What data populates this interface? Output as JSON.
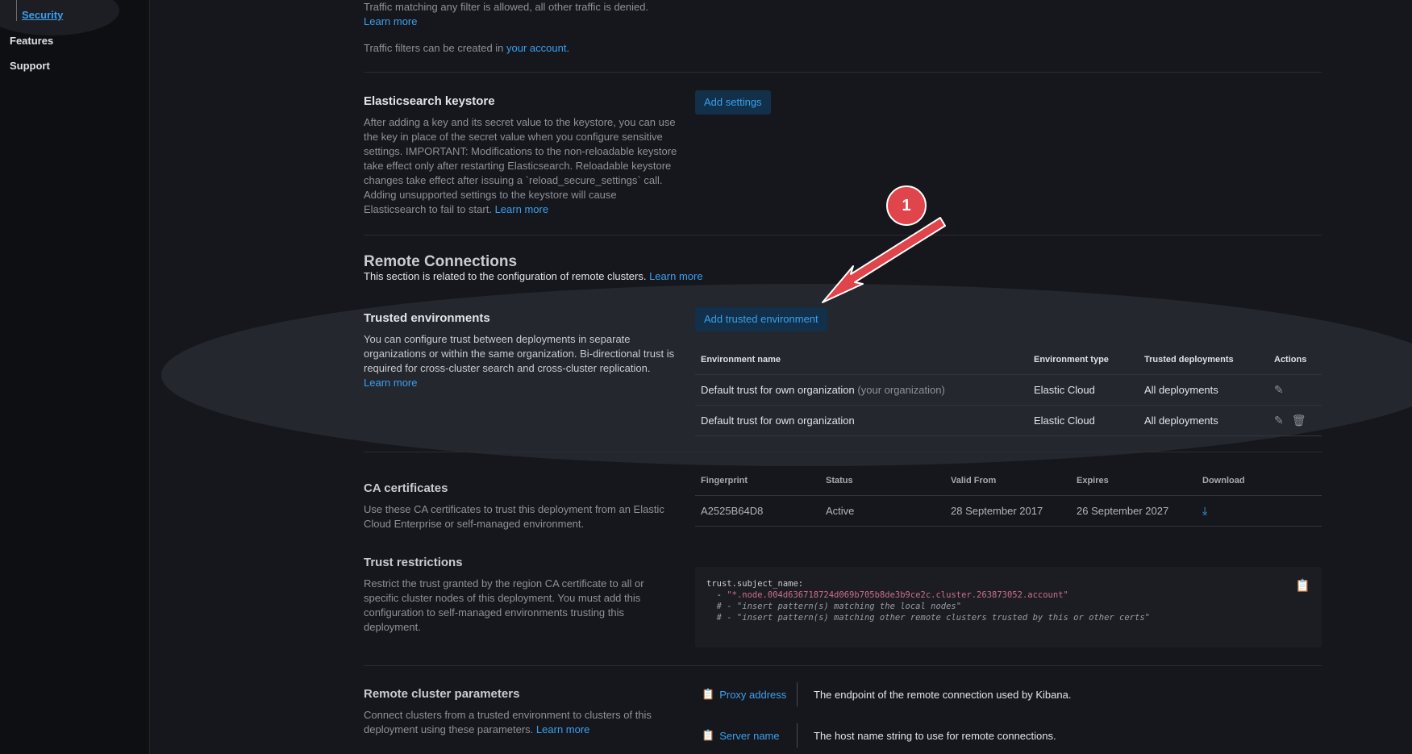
{
  "sidebar": {
    "items": [
      {
        "label": "Security"
      },
      {
        "label": "Features"
      },
      {
        "label": "Support"
      }
    ]
  },
  "traffic": {
    "line1": "Traffic matching any filter is allowed, all other traffic is denied.",
    "learn_more": "Learn more",
    "created_prefix": "Traffic filters can be created in ",
    "account_link": "your account",
    "created_suffix": "."
  },
  "keystore": {
    "title": "Elasticsearch keystore",
    "description": "After adding a key and its secret value to the keystore, you can use the key in place of the secret value when you configure sensitive settings. IMPORTANT: Modifications to the non-reloadable keystore take effect only after restarting Elasticsearch. Reloadable keystore changes take effect after issuing a `reload_secure_settings` call. Adding unsupported settings to the keystore will cause Elasticsearch to fail to start.",
    "learn_more": "Learn more",
    "button": "Add settings"
  },
  "remote": {
    "heading": "Remote Connections",
    "subtitle": "This section is related to the configuration of remote clusters.",
    "learn_more": "Learn more"
  },
  "trusted": {
    "title": "Trusted environments",
    "description": "You can configure trust between deployments in separate organizations or within the same organization. Bi-directional trust is required for cross-cluster search and cross-cluster replication.",
    "learn_more": "Learn more",
    "button": "Add trusted environment",
    "columns": [
      "Environment name",
      "Environment type",
      "Trusted deployments",
      "Actions"
    ],
    "rows": [
      {
        "name": "Default trust for own organization",
        "suffix": "(your organization)",
        "type": "Elastic Cloud",
        "deployments": "All deployments"
      },
      {
        "name": "Default trust for own organization",
        "suffix": "",
        "type": "Elastic Cloud",
        "deployments": "All deployments"
      }
    ]
  },
  "ca": {
    "title": "CA certificates",
    "description": "Use these CA certificates to trust this deployment from an Elastic Cloud Enterprise or self-managed environment.",
    "columns": [
      "Fingerprint",
      "Status",
      "Valid From",
      "Expires",
      "Download"
    ],
    "row": {
      "fingerprint": "A2525B64D8",
      "status": "Active",
      "valid_from": "28 September 2017",
      "expires": "26 September 2027"
    }
  },
  "restrictions": {
    "title": "Trust restrictions",
    "description": "Restrict the trust granted by the region CA certificate to all or specific cluster nodes of this deployment. You must add this configuration to self-managed environments trusting this deployment.",
    "code_line1": "trust.subject_name:",
    "code_line2_prefix": "  - ",
    "code_line2_str": "\"*.node.004d636718724d069b705b8de3b9ce2c.cluster.263873052.account\"",
    "code_line3": "  # - \"insert pattern(s) matching the local nodes\"",
    "code_line4": "  # - \"insert pattern(s) matching other remote clusters trusted by this or other certs\""
  },
  "params": {
    "title": "Remote cluster parameters",
    "description": "Connect clusters from a trusted environment to clusters of this deployment using these parameters.",
    "learn_more": "Learn more",
    "items": [
      {
        "name": "Proxy address",
        "desc": "The endpoint of the remote connection used by Kibana."
      },
      {
        "name": "Server name",
        "desc": "The host name string to use for remote connections."
      }
    ]
  },
  "annotation": {
    "number": "1"
  },
  "colors": {
    "accent": "#3aa0f0",
    "callout": "#e0454b",
    "background": "#16171c"
  }
}
